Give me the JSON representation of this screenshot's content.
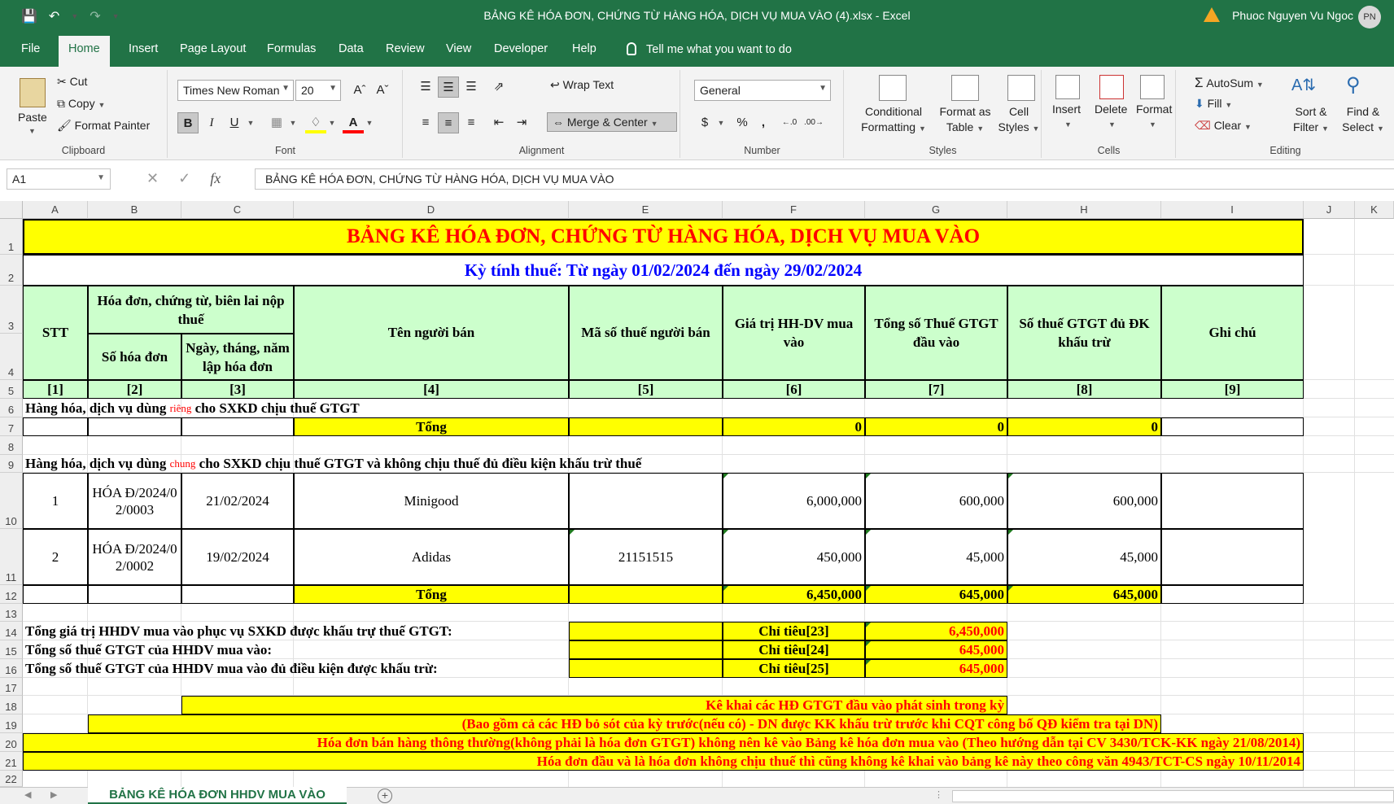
{
  "window": {
    "title": "BẢNG KÊ HÓA ĐƠN, CHỨNG TỪ HÀNG HÓA, DỊCH VỤ MUA VÀO (4).xlsx  -  Excel",
    "user_name": "Phuoc Nguyen Vu Ngoc",
    "user_initials": "PN"
  },
  "tabs": [
    "File",
    "Home",
    "Insert",
    "Page Layout",
    "Formulas",
    "Data",
    "Review",
    "View",
    "Developer",
    "Help"
  ],
  "active_tab": "Home",
  "tell_me": "Tell me what you want to do",
  "ribbon": {
    "clipboard": {
      "paste": "Paste",
      "cut": "Cut",
      "copy": "Copy",
      "format_painter": "Format Painter",
      "label": "Clipboard"
    },
    "font": {
      "name": "Times New Roman",
      "size": "20",
      "bold": "B",
      "italic": "I",
      "underline": "U",
      "label": "Font"
    },
    "alignment": {
      "wrap_text": "Wrap Text",
      "merge_center": "Merge & Center",
      "label": "Alignment"
    },
    "number": {
      "format": "General",
      "currency": "$",
      "percent": "%",
      "comma": ",",
      "label": "Number"
    },
    "styles": {
      "conditional": "Conditional",
      "conditional2": "Formatting",
      "format_as": "Format as",
      "format_as2": "Table",
      "cell": "Cell",
      "cell2": "Styles",
      "label": "Styles"
    },
    "cells": {
      "insert": "Insert",
      "delete": "Delete",
      "format": "Format",
      "label": "Cells"
    },
    "editing": {
      "autosum": "AutoSum",
      "fill": "Fill",
      "clear": "Clear",
      "sort": "Sort &",
      "sort2": "Filter",
      "find": "Find &",
      "find2": "Select",
      "label": "Editing"
    }
  },
  "formula_bar": {
    "name_box": "A1",
    "formula": "BẢNG KÊ HÓA ĐƠN, CHỨNG TỪ HÀNG HÓA, DỊCH VỤ MUA VÀO"
  },
  "columns": [
    "A",
    "B",
    "C",
    "D",
    "E",
    "F",
    "G",
    "H",
    "I",
    "J",
    "K"
  ],
  "rows": [
    "1",
    "2",
    "3",
    "4",
    "5",
    "6",
    "7",
    "8",
    "9",
    "10",
    "11",
    "12",
    "13",
    "14",
    "15",
    "16",
    "17",
    "18",
    "19",
    "20",
    "21",
    "22"
  ],
  "sheet": {
    "title": "BẢNG KÊ HÓA ĐƠN, CHỨNG TỪ HÀNG HÓA, DỊCH VỤ MUA VÀO",
    "period": "Kỳ tính thuế: Từ ngày 01/02/2024 đến ngày 29/02/2024",
    "headers": {
      "stt": "STT",
      "invoice_group": "Hóa đơn, chứng từ, biên lai nộp thuế",
      "invoice_no": "Số hóa đơn",
      "invoice_date": "Ngày, tháng, năm lập hóa đơn",
      "seller": "Tên người bán",
      "tax_code": "Mã số thuế người bán",
      "value": "Giá trị HH-DV mua vào",
      "vat_total": "Tổng số Thuế GTGT đầu vào",
      "vat_deductible": "Số thuế GTGT đủ ĐK khấu trừ",
      "note": "Ghi chú"
    },
    "col_numbers": [
      "[1]",
      "[2]",
      "[3]",
      "[4]",
      "[5]",
      "[6]",
      "[7]",
      "[8]",
      "[9]"
    ],
    "section1": {
      "label_a": "Hàng hóa, dịch vụ dùng ",
      "label_red": "riêng",
      "label_b": " cho SXKD chịu thuế GTGT"
    },
    "section1_total": {
      "label": "Tổng",
      "value": "0",
      "vat": "0",
      "vat_deductible": "0"
    },
    "section2": {
      "label_a": "Hàng hóa, dịch vụ dùng ",
      "label_red": "chung",
      "label_b": " cho SXKD chịu thuế GTGT và không chịu thuế đủ điều kiện khấu trừ thuế"
    },
    "items": [
      {
        "stt": "1",
        "invoice_no": "HÓA Đ/2024/02/0003",
        "date": "21/02/2024",
        "seller": "Minigood",
        "tax_code": "",
        "value": "6,000,000",
        "vat": "600,000",
        "vat_deductible": "600,000"
      },
      {
        "stt": "2",
        "invoice_no": "HÓA Đ/2024/02/0002",
        "date": "19/02/2024",
        "seller": "Adidas",
        "tax_code": "21151515",
        "value": "450,000",
        "vat": "45,000",
        "vat_deductible": "45,000"
      }
    ],
    "section2_total": {
      "label": "Tổng",
      "value": "6,450,000",
      "vat": "645,000",
      "vat_deductible": "645,000"
    },
    "summary": [
      {
        "label": "Tổng giá trị HHDV mua vào phục vụ SXKD được khấu trự thuế GTGT:",
        "indicator": "Chỉ tiêu[23]",
        "value": "6,450,000"
      },
      {
        "label": "Tổng số thuế GTGT của HHDV mua vào:",
        "indicator": "Chỉ tiêu[24]",
        "value": "645,000"
      },
      {
        "label": "Tổng số thuế GTGT của HHDV mua vào đủ điều kiện được khấu trừ:",
        "indicator": "Chỉ tiêu[25]",
        "value": "645,000"
      }
    ],
    "notes": [
      "Kê khai các HĐ GTGT đầu vào phát sinh trong kỳ",
      "(Bao gồm cả các HĐ bỏ sót của kỳ trước(nếu có) - DN được KK khấu trừ trước khi CQT công bố QĐ kiểm tra tại DN)",
      "Hóa đơn bán hàng thông thường(không phải là hóa đơn GTGT) không nên kê vào Bảng kê hóa đơn mua vào (Theo hướng dẫn tại CV 3430/TCK-KK ngày 21/08/2014)",
      "Hóa đơn đầu và là hóa đơn không chịu thuế thì cũng không kê khai vào bảng kê này theo công văn 4943/TCT-CS ngày 10/11/2014"
    ]
  },
  "sheet_tab": "BẢNG KÊ HÓA ĐƠN HHDV MUA VÀO",
  "colors": {
    "excel_green": "#217346",
    "highlight_yellow": "#ffff00",
    "header_green": "#ccffcc",
    "red": "#ff0000",
    "blue": "#0000ff"
  }
}
